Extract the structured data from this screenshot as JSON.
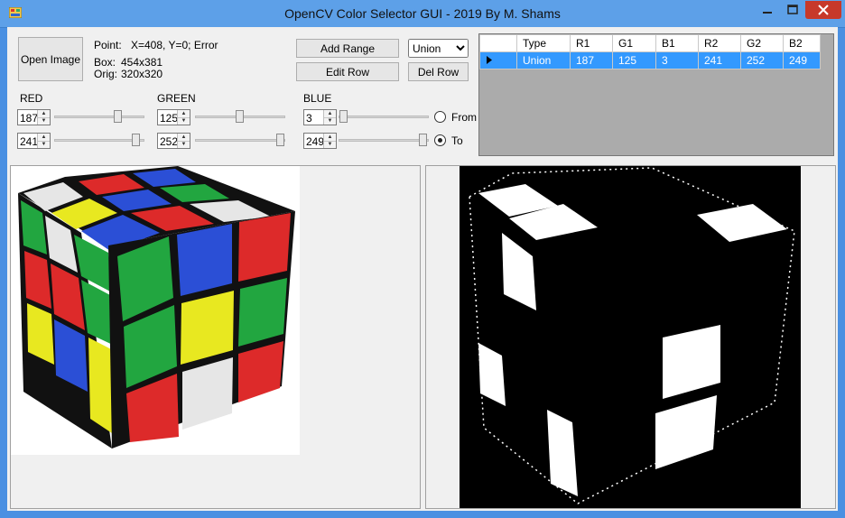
{
  "window": {
    "title": "OpenCV Color Selector GUI - 2019 By M. Shams",
    "accent": "#4a90e2",
    "close_color": "#c7392a"
  },
  "controls": {
    "open_image": "Open Image",
    "point_label": "Point:",
    "point_value": "X=408, Y=0; Error",
    "box_label": "Box:",
    "box_value": "454x381",
    "orig_label": "Orig:",
    "orig_value": "320x320",
    "add_range": "Add Range",
    "edit_row": "Edit Row",
    "del_row": "Del Row",
    "mode_selected": "Union"
  },
  "channels": {
    "red": {
      "label": "RED",
      "from": "187",
      "to": "241",
      "from_fraction": 0.73,
      "to_fraction": 0.95
    },
    "green": {
      "label": "GREEN",
      "from": "125",
      "to": "252",
      "from_fraction": 0.49,
      "to_fraction": 0.99
    },
    "blue": {
      "label": "BLUE",
      "from": "3",
      "to": "249",
      "from_fraction": 0.01,
      "to_fraction": 0.98
    }
  },
  "range_radio": {
    "from_label": "From",
    "to_label": "To",
    "selected": "To"
  },
  "table": {
    "columns": [
      "Type",
      "R1",
      "G1",
      "B1",
      "R2",
      "G2",
      "B2"
    ],
    "rows": [
      [
        "Union",
        "187",
        "125",
        "3",
        "241",
        "252",
        "249"
      ]
    ],
    "selected_row": 0
  },
  "cube_colors": {
    "white": "#e6e6e6",
    "red": "#dd2a2a",
    "blue": "#2b4fd6",
    "green": "#22a640",
    "yellow": "#e8e820"
  }
}
